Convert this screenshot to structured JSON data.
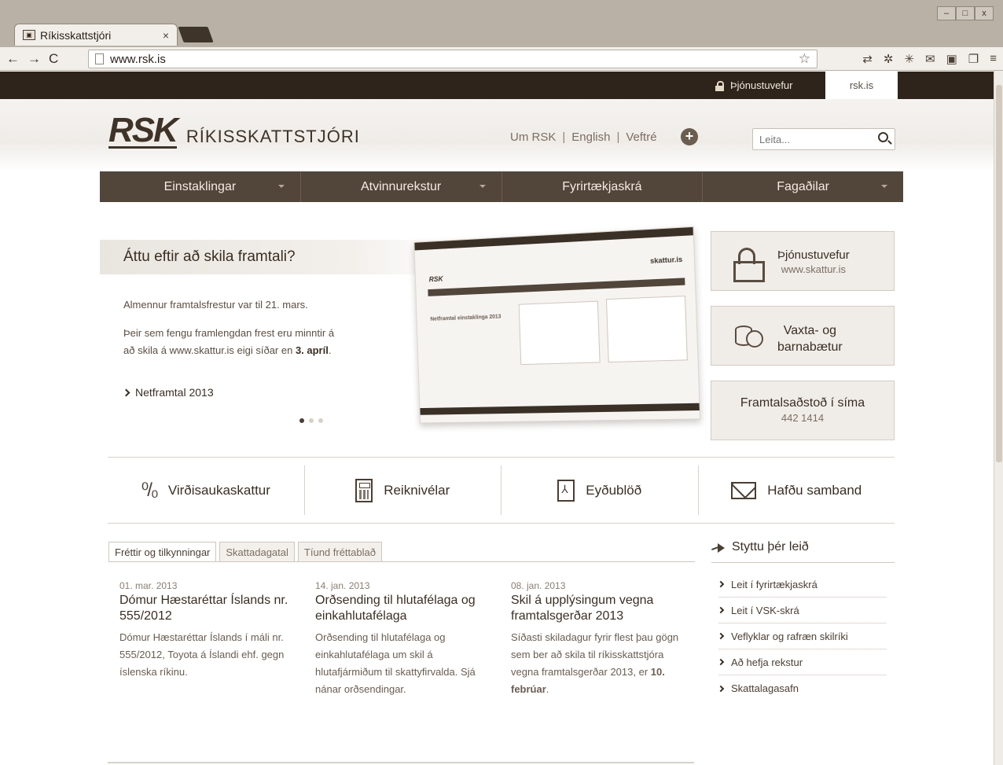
{
  "browser": {
    "tab_title": "Ríkisskattstjóri",
    "url": "www.rsk.is",
    "win_controls": [
      "–",
      "□",
      "x"
    ]
  },
  "topstrip": {
    "service_label": "Þjónustuvefur",
    "site_label": "rsk.is"
  },
  "header": {
    "logo_mark": "RSK",
    "logo_text": "RÍKISSKATTSTJÓRI",
    "links": [
      "Um RSK",
      "English",
      "Veftré"
    ],
    "separator": "|",
    "plus_icon": "+",
    "search_placeholder": "Leita..."
  },
  "nav": {
    "items": [
      "Einstaklingar",
      "Atvinnurekstur",
      "Fyrirtækjaskrá",
      "Fagaðilar"
    ]
  },
  "hero": {
    "title": "Áttu eftir að skila framtali?",
    "p1": "Almennur framtalsfrestur var til 21. mars.",
    "p2_start": "Þeir sem fengu framlengdan frest eru minntir á að skila á www.skattur.is eigi síðar en ",
    "p2_bold": "3. apríl",
    "p2_end": ".",
    "link": "Netframtal 2013",
    "slides": 3,
    "active_slide": 1,
    "screenshot": {
      "logo": "RSK",
      "brand": "skattur.is",
      "heading": "Netframtal einstaklinga 2013"
    }
  },
  "sideboxes": [
    {
      "title": "Þjónustuvefur",
      "subtitle": "www.skattur.is",
      "icon": "lock-icon"
    },
    {
      "title_line1": "Vaxta- og",
      "title_line2": "barnabætur",
      "icon": "coins-icon"
    },
    {
      "title": "Framtalsaðstoð í síma",
      "subtitle": "442 1414"
    }
  ],
  "quick_links": [
    {
      "label": "Virðisaukaskattur",
      "icon": "percent-icon",
      "glyph": "⁰/₀"
    },
    {
      "label": "Reiknivélar",
      "icon": "calculator-icon"
    },
    {
      "label": "Eyðublöð",
      "icon": "pdf-icon"
    },
    {
      "label": "Hafðu samband",
      "icon": "envelope-icon"
    }
  ],
  "news": {
    "tabs": [
      "Fréttir og tilkynningar",
      "Skattadagatal",
      "Tíund fréttablað"
    ],
    "active_tab": 0,
    "items": [
      {
        "date": "01. mar. 2013",
        "title": "Dómur Hæstaréttar Íslands nr. 555/2012",
        "body": "Dómur Hæstaréttar Íslands í máli nr. 555/2012, Toyota á Íslandi ehf. gegn íslenska ríkinu."
      },
      {
        "date": "14. jan. 2013",
        "title": "Orðsending til hlutafélaga og einkahlutafélaga",
        "body": "Orðsending til hlutafélaga og einkahlutafélaga um skil á hlutafjármiðum til skattyfirvalda.  Sjá nánar orðsendingar."
      },
      {
        "date": "08. jan. 2013",
        "title": "Skil á upplýsingum vegna framtalsgerðar 2013",
        "body_start": "Síðasti skiladagur fyrir flest þau gögn sem ber að skila til ríkisskattstjóra vegna framtalsgerðar 2013, er ",
        "body_bold": "10. febrúar",
        "body_end": "."
      }
    ]
  },
  "shortcuts": {
    "title": "Styttu þér leið",
    "links": [
      "Leit í fyrirtækjaskrá",
      "Leit í VSK-skrá",
      "Veflyklar og rafræn skilríki",
      "Að hefja rekstur",
      "Skattalagasafn"
    ]
  }
}
